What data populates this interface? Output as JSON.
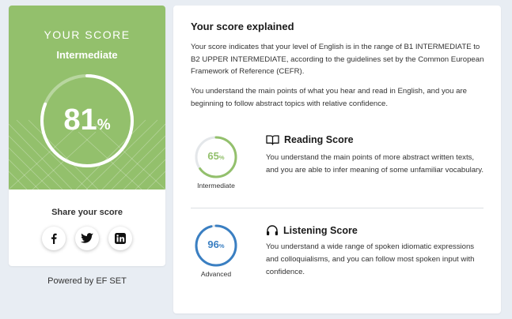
{
  "score_card": {
    "heading": "YOUR SCORE",
    "level": "Intermediate",
    "score_value": 81,
    "score_number": "81",
    "percent_sign": "%",
    "share_label": "Share your score",
    "social": [
      {
        "icon": "facebook-icon"
      },
      {
        "icon": "twitter-icon"
      },
      {
        "icon": "linkedin-icon"
      }
    ],
    "colors": {
      "hero_green": "#93c06c"
    }
  },
  "footer": {
    "powered_by": "Powered by EF SET"
  },
  "explanation": {
    "title": "Your score explained",
    "paragraph1": "Your score indicates that your level of English is in the range of B1 INTERMEDIATE to B2 UPPER INTERMEDIATE, according to the guidelines set by the Common European Framework of Reference (CEFR).",
    "paragraph2": "You understand the main points of what you hear and read in English, and you are beginning to follow abstract topics with relative confidence."
  },
  "skills": {
    "reading": {
      "score_number": "65",
      "score_value": 65,
      "percent_sign": "%",
      "level": "Intermediate",
      "title": "Reading Score",
      "icon": "book-icon",
      "description": "You understand the main points of more abstract written texts, and you are able to infer meaning of some unfamiliar vocabulary.",
      "color": "#93c06c"
    },
    "listening": {
      "score_number": "96",
      "score_value": 96,
      "percent_sign": "%",
      "level": "Advanced",
      "title": "Listening Score",
      "icon": "headphones-icon",
      "description": "You understand a wide range of spoken idiomatic expressions and colloquialisms, and you can follow most spoken input with confidence.",
      "color": "#3a7fc2"
    }
  }
}
